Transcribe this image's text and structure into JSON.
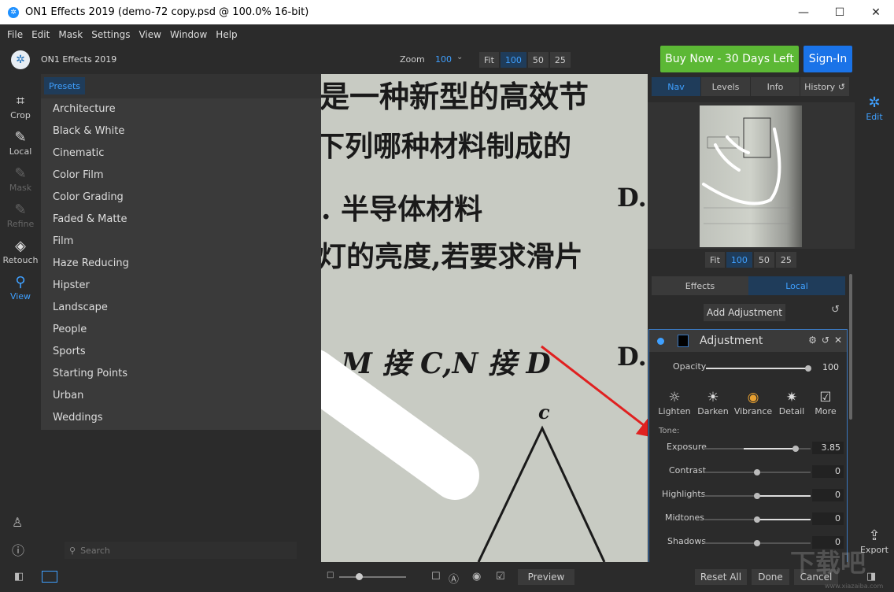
{
  "window": {
    "title": "ON1 Effects 2019 (demo-72 copy.psd @ 100.0% 16-bit)",
    "minimize": "—",
    "maximize": "☐",
    "close": "✕"
  },
  "menu": [
    "File",
    "Edit",
    "Mask",
    "Settings",
    "View",
    "Window",
    "Help"
  ],
  "header": {
    "app_name": "ON1 Effects 2019",
    "zoom_label": "Zoom",
    "zoom_value": "100",
    "zoom_buttons": [
      "Fit",
      "100",
      "50",
      "25"
    ],
    "buy_now": "Buy Now - 30 Days Left",
    "sign_in": "Sign-In"
  },
  "tools": [
    {
      "label": "Crop",
      "icon": "crop-icon"
    },
    {
      "label": "Local",
      "icon": "brush-icon"
    },
    {
      "label": "Mask",
      "icon": "mask-brush-icon"
    },
    {
      "label": "Refine",
      "icon": "refine-brush-icon"
    },
    {
      "label": "Retouch",
      "icon": "eraser-icon"
    },
    {
      "label": "View",
      "icon": "magnifier-icon"
    }
  ],
  "presets": {
    "tab": "Presets",
    "items": [
      "Architecture",
      "Black & White",
      "Cinematic",
      "Color Film",
      "Color Grading",
      "Faded & Matte",
      "Film",
      "Haze Reducing",
      "Hipster",
      "Landscape",
      "People",
      "Sports",
      "Starting Points",
      "Urban",
      "Weddings"
    ],
    "search_placeholder": "Search"
  },
  "canvas_text": {
    "line1": "是一种新型的高效节",
    "line2": "下列哪种材料制成的",
    "line3": ". 半导体材料",
    "line3_right": "D.",
    "line4": "灯的亮度,若要求滑片",
    "line5": ". M 接 C,N 接 D",
    "line5_right": "D.",
    "label_c": "c"
  },
  "right_panel": {
    "nav_tabs": [
      "Nav",
      "Levels",
      "Info",
      "History ↺"
    ],
    "nav_zoom": [
      "Fit",
      "100",
      "50",
      "25"
    ],
    "tabs2": [
      "Effects",
      "Local"
    ],
    "add_adjustment": "Add Adjustment",
    "adjustment": {
      "title": "Adjustment",
      "opacity_label": "Opacity",
      "opacity_value": "100",
      "modes": [
        "Lighten",
        "Darken",
        "Vibrance",
        "Detail",
        "More"
      ],
      "tone_label": "Tone:",
      "sliders": [
        {
          "label": "Exposure",
          "value": "3.85"
        },
        {
          "label": "Contrast",
          "value": "0"
        },
        {
          "label": "Highlights",
          "value": "0"
        },
        {
          "label": "Midtones",
          "value": "0"
        },
        {
          "label": "Shadows",
          "value": "0"
        }
      ]
    }
  },
  "side": {
    "edit": "Edit",
    "export": "Export"
  },
  "bottom": {
    "preview": "Preview",
    "reset_all": "Reset All",
    "done": "Done",
    "cancel": "Cancel"
  },
  "watermark": "下载吧",
  "watermark_url": "www.xiazaiba.com",
  "colors": {
    "accent": "#3fa0ff",
    "buy_now": "#5cb835",
    "sign_in": "#1a73e8",
    "arrow": "#e02020"
  }
}
